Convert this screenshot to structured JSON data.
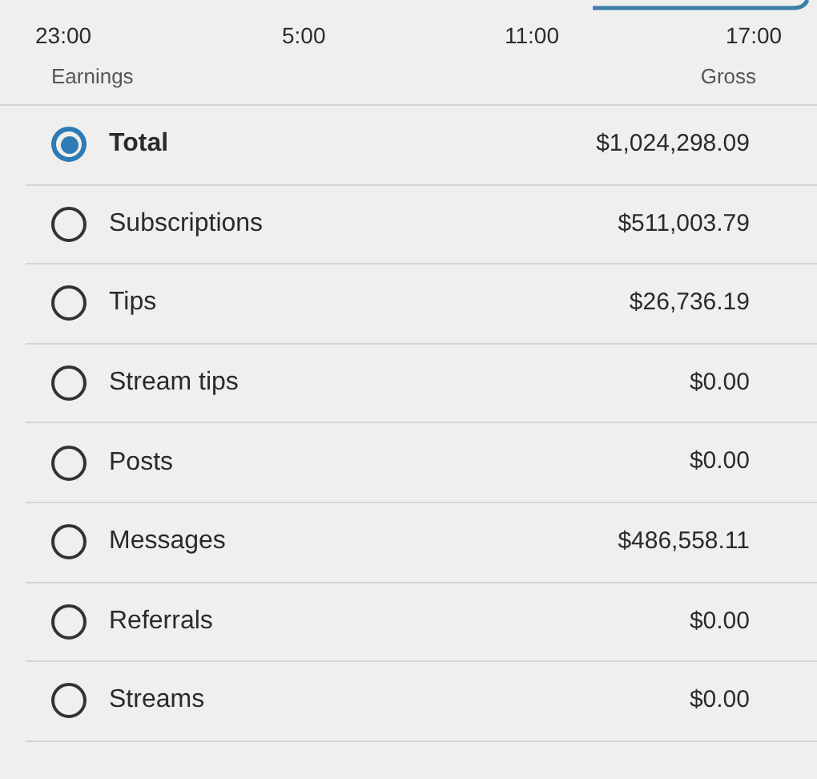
{
  "chart_axis": {
    "ticks": [
      "23:00",
      "5:00",
      "11:00",
      "17:00"
    ]
  },
  "header": {
    "left": "Earnings",
    "right": "Gross"
  },
  "rows": [
    {
      "label": "Total",
      "amount": "$1,024,298.09",
      "selected": true
    },
    {
      "label": "Subscriptions",
      "amount": "$511,003.79",
      "selected": false
    },
    {
      "label": "Tips",
      "amount": "$26,736.19",
      "selected": false
    },
    {
      "label": "Stream tips",
      "amount": "$0.00",
      "selected": false
    },
    {
      "label": "Posts",
      "amount": "$0.00",
      "selected": false
    },
    {
      "label": "Messages",
      "amount": "$486,558.11",
      "selected": false
    },
    {
      "label": "Referrals",
      "amount": "$0.00",
      "selected": false
    },
    {
      "label": "Streams",
      "amount": "$0.00",
      "selected": false
    }
  ]
}
